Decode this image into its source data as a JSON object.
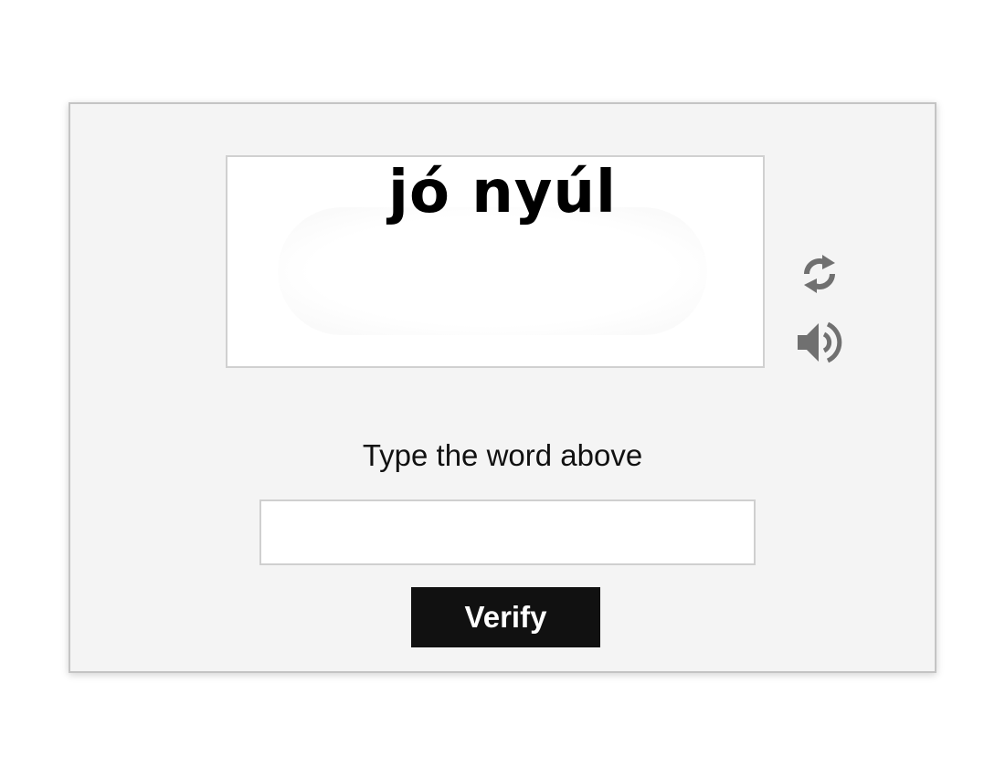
{
  "captcha": {
    "word": "jó nyúl",
    "refresh_icon": "refresh-icon",
    "audio_icon": "speaker-icon"
  },
  "form": {
    "prompt": "Type the word above",
    "input_value": "",
    "input_placeholder": "",
    "verify_label": "Verify"
  },
  "colors": {
    "panel_background": "#f4f4f4",
    "button_background": "#111111",
    "button_text": "#ffffff",
    "icon": "#707070"
  }
}
